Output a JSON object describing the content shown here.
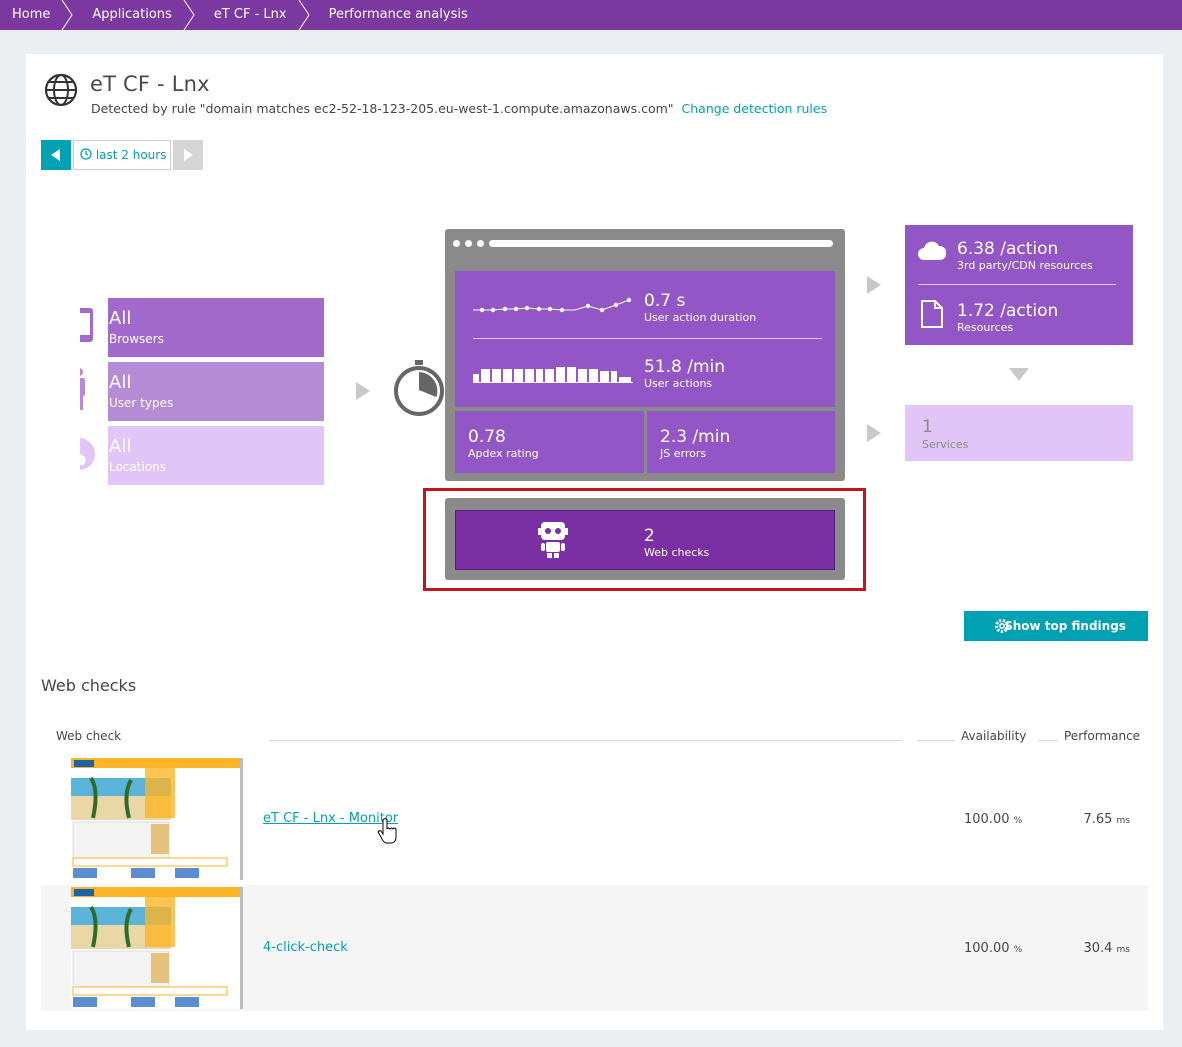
{
  "breadcrumbs": [
    "Home",
    "Applications",
    "eT CF - Lnx",
    "Performance analysis"
  ],
  "header": {
    "title": "eT CF - Lnx",
    "detection_text": "Detected by rule \"domain matches ec2-52-18-123-205.eu-west-1.compute.amazonaws.com\"",
    "change_link": "Change detection rules"
  },
  "timeframe": {
    "label": "last 2 hours"
  },
  "filters": [
    {
      "value": "All",
      "label": "Browsers",
      "icon": "mobile-icon"
    },
    {
      "value": "All",
      "label": "User types",
      "icon": "person-icon"
    },
    {
      "value": "All",
      "label": "Locations",
      "icon": "globe-icon"
    }
  ],
  "metrics": {
    "duration_value": "0.7 s",
    "duration_label": "User action duration",
    "actions_value": "51.8 /min",
    "actions_label": "User actions",
    "apdex_value": "0.78",
    "apdex_label": "Apdex rating",
    "jserrors_value": "2.3 /min",
    "jserrors_label": "JS errors",
    "webchecks_value": "2",
    "webchecks_label": "Web checks"
  },
  "resources": {
    "third_party_value": "6.38 /action",
    "third_party_label": "3rd party/CDN resources",
    "resources_value": "1.72 /action",
    "resources_label": "Resources",
    "services_value": "1",
    "services_label": "Services"
  },
  "findings_button": "Show top findings",
  "section_title": "Web checks",
  "table": {
    "headers": {
      "webcheck": "Web check",
      "availability": "Availability",
      "performance": "Performance"
    },
    "rows": [
      {
        "name": "eT CF - Lnx - Monitor",
        "availability": "100.00",
        "availability_unit": "%",
        "performance": "7.65",
        "performance_unit": "ms"
      },
      {
        "name": "4-click-check",
        "availability": "100.00",
        "availability_unit": "%",
        "performance": "30.4",
        "performance_unit": "ms"
      }
    ]
  },
  "colors": {
    "brand": "#7c38a1",
    "accent": "#00a1b2",
    "highlight": "#c5151a"
  }
}
